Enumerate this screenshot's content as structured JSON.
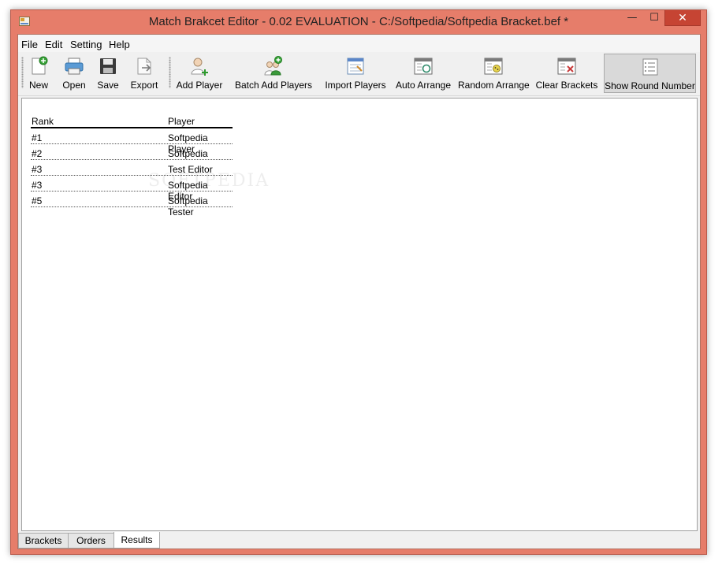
{
  "window": {
    "title": "Match Brakcet Editor - 0.02 EVALUATION - C:/Softpedia/Softpedia Bracket.bef *",
    "controls": {
      "minimize": "—",
      "maximize": "☐",
      "close": "✕"
    }
  },
  "menu": {
    "items": [
      "File",
      "Edit",
      "Setting",
      "Help"
    ]
  },
  "toolbar": {
    "tools": [
      {
        "label": "New",
        "icon": "new-file-icon"
      },
      {
        "label": "Open",
        "icon": "open-printer-icon"
      },
      {
        "label": "Save",
        "icon": "save-floppy-icon"
      },
      {
        "label": "Export",
        "icon": "export-icon"
      },
      {
        "label": "Add Player",
        "icon": "add-player-icon"
      },
      {
        "label": "Batch Add Players",
        "icon": "batch-add-players-icon"
      },
      {
        "label": "Import Players",
        "icon": "import-players-icon"
      },
      {
        "label": "Auto Arrange",
        "icon": "auto-arrange-icon"
      },
      {
        "label": "Random Arrange",
        "icon": "random-arrange-icon"
      },
      {
        "label": "Clear Brackets",
        "icon": "clear-brackets-icon"
      },
      {
        "label": "Show Round Number",
        "icon": "show-round-number-icon",
        "active": true
      }
    ]
  },
  "results": {
    "headers": {
      "rank": "Rank",
      "player": "Player"
    },
    "rows": [
      {
        "rank": "#1",
        "player": "Softpedia Player"
      },
      {
        "rank": "#2",
        "player": "Softpedia"
      },
      {
        "rank": "#3",
        "player": "Test Editor"
      },
      {
        "rank": "#3",
        "player": "Softpedia Editor"
      },
      {
        "rank": "#5",
        "player": "Softpedia Tester"
      }
    ]
  },
  "tabs": {
    "items": [
      "Brackets",
      "Orders",
      "Results"
    ],
    "selected": "Results"
  },
  "watermark": "SOFTPEDIA",
  "colors": {
    "frame": "#e67d6a",
    "close_button": "#c64433",
    "active_tool_bg": "#d9d9d9"
  }
}
